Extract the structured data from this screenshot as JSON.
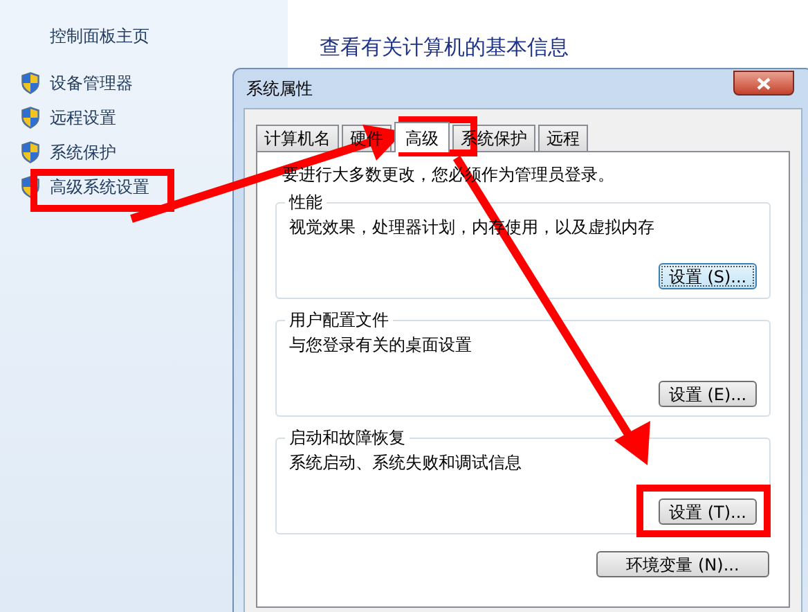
{
  "sidebar": {
    "title": "控制面板主页",
    "items": [
      {
        "label": "设备管理器"
      },
      {
        "label": "远程设置"
      },
      {
        "label": "系统保护"
      },
      {
        "label": "高级系统设置"
      }
    ]
  },
  "main": {
    "heading": "查看有关计算机的基本信息"
  },
  "dialog": {
    "title": "系统属性",
    "tabs": [
      {
        "label": "计算机名",
        "selected": false
      },
      {
        "label": "硬件",
        "selected": false
      },
      {
        "label": "高级",
        "selected": true
      },
      {
        "label": "系统保护",
        "selected": false
      },
      {
        "label": "远程",
        "selected": false
      }
    ],
    "notice": "要进行大多数更改，您必须作为管理员登录。",
    "groups": [
      {
        "title": "性能",
        "description": "视觉效果，处理器计划，内存使用，以及虚拟内存",
        "button": "设置 (S)...",
        "focused": true
      },
      {
        "title": "用户配置文件",
        "description": "与您登录有关的桌面设置",
        "button": "设置 (E)...",
        "focused": false
      },
      {
        "title": "启动和故障恢复",
        "description": "系统启动、系统失败和调试信息",
        "button": "设置 (T)...",
        "focused": false
      }
    ],
    "env_button": "环境变量 (N)..."
  }
}
